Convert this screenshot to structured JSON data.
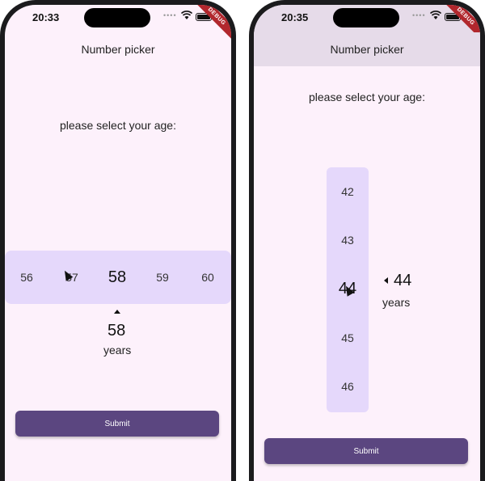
{
  "left_screen": {
    "status_time": "20:33",
    "title": "Number picker",
    "prompt": "please select your age:",
    "picker_values": [
      "56",
      "57",
      "58",
      "59",
      "60"
    ],
    "selected_value": "58",
    "unit": "years",
    "submit_label": "Submit"
  },
  "right_screen": {
    "status_time": "20:35",
    "title": "Number picker",
    "prompt": "please select your age:",
    "picker_values": [
      "42",
      "43",
      "44",
      "45",
      "46"
    ],
    "selected_value": "44",
    "unit": "years",
    "submit_label": "Submit"
  },
  "debug_banner": "DEBUG",
  "colors": {
    "background": "#fdf1fb",
    "picker": "#e5d8fb",
    "button": "#5b4680",
    "appbar_scrolled": "#e6dbe9",
    "debug_banner": "#b1272d"
  }
}
